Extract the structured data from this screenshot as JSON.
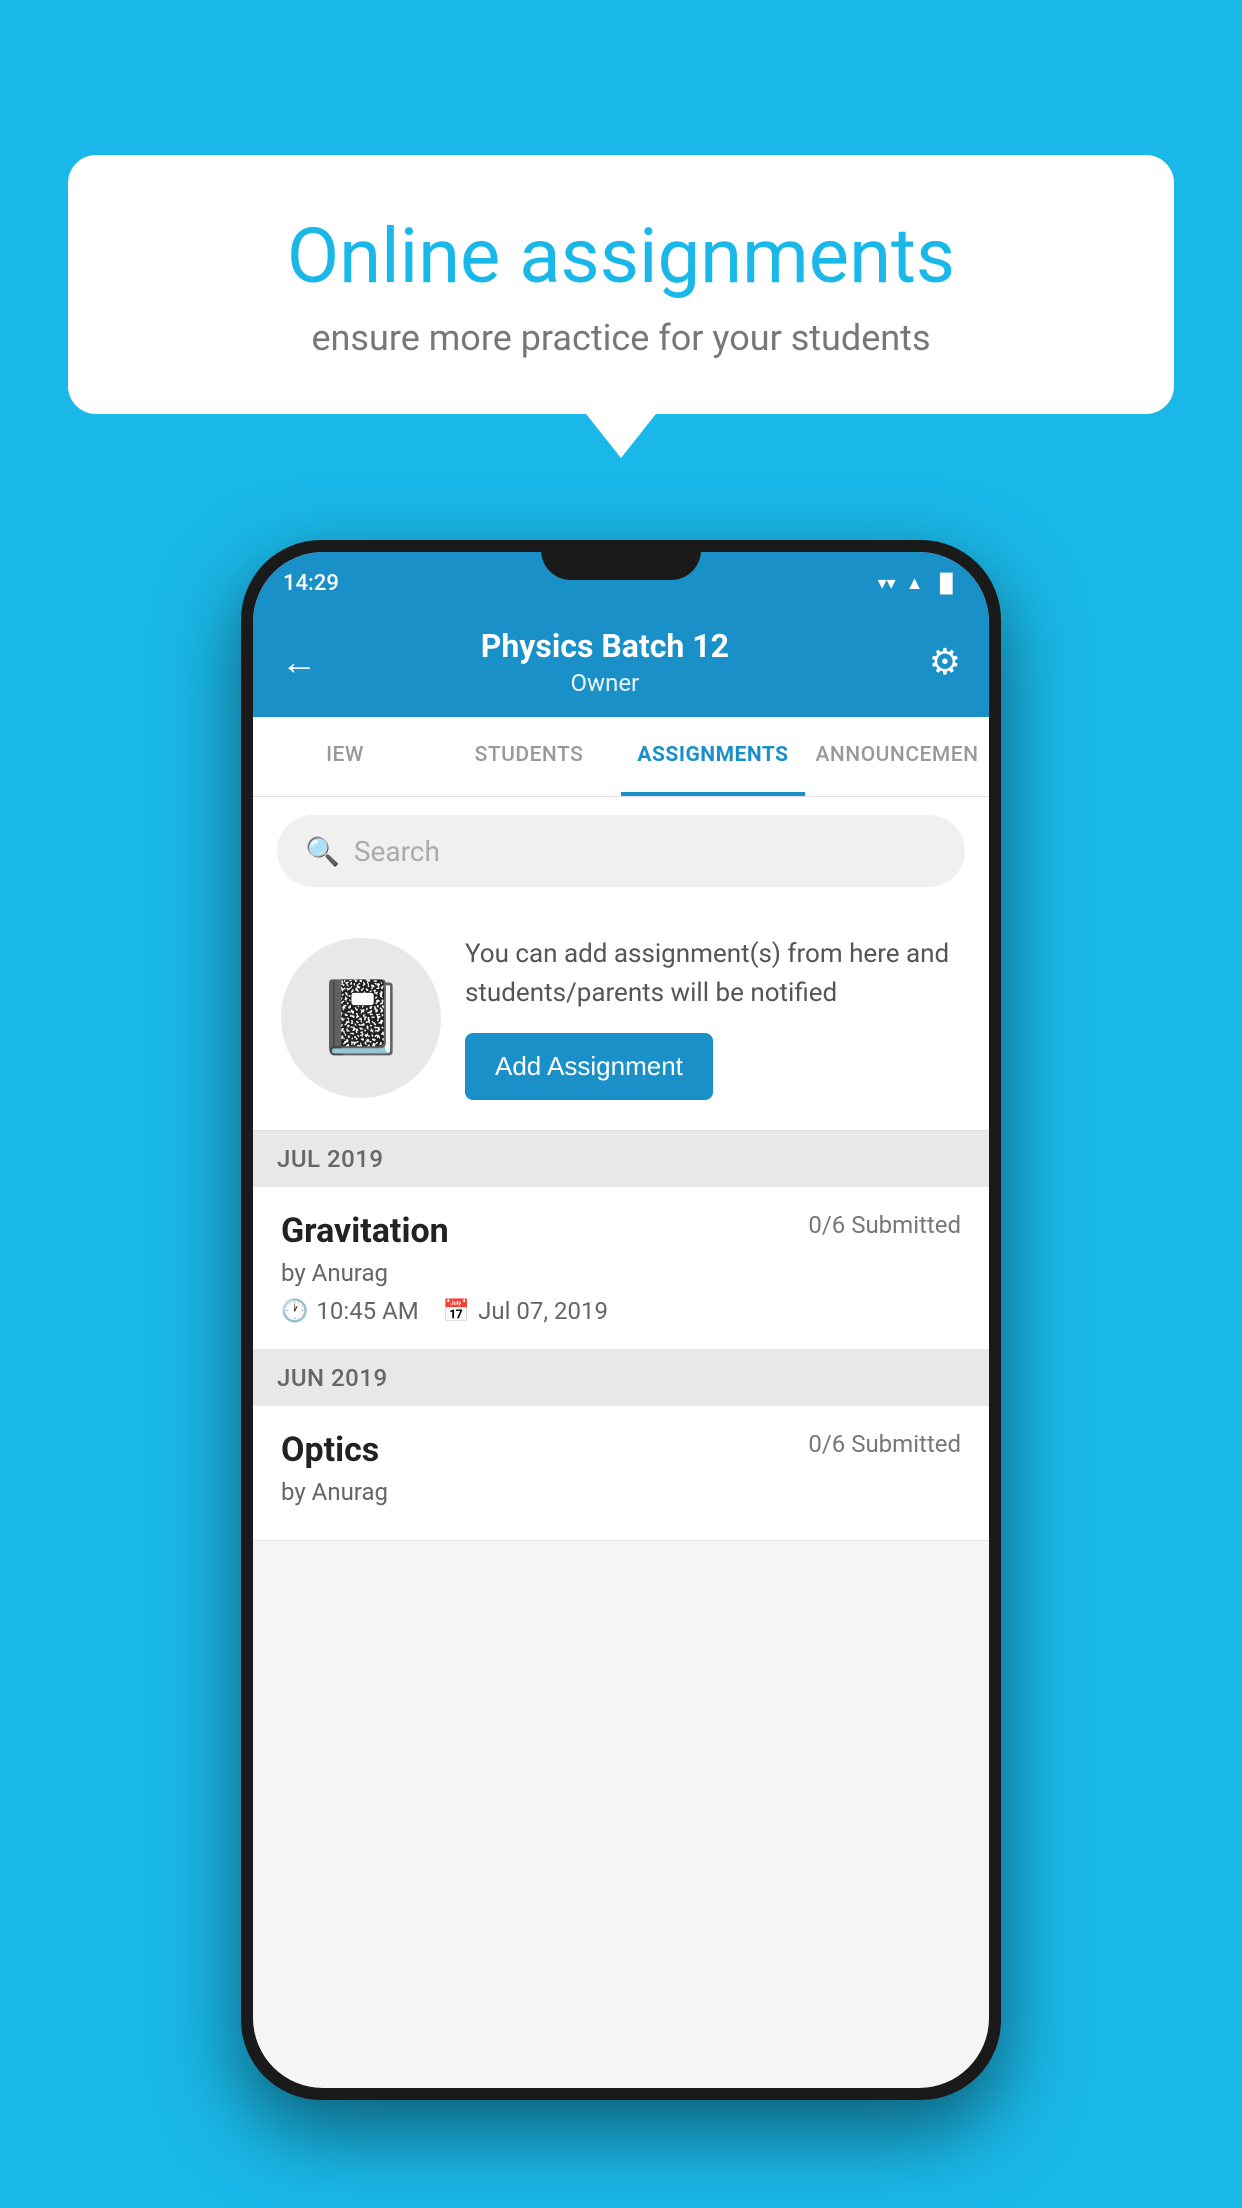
{
  "background": {
    "color": "#1ab8e8"
  },
  "speech_bubble": {
    "title": "Online assignments",
    "subtitle": "ensure more practice for your students"
  },
  "status_bar": {
    "time": "14:29",
    "wifi_icon": "▼",
    "signal_icon": "▲",
    "battery_icon": "▐"
  },
  "app_bar": {
    "title": "Physics Batch 12",
    "subtitle": "Owner",
    "back_icon": "←",
    "settings_icon": "⚙"
  },
  "tabs": [
    {
      "label": "IEW",
      "active": false
    },
    {
      "label": "STUDENTS",
      "active": false
    },
    {
      "label": "ASSIGNMENTS",
      "active": true
    },
    {
      "label": "ANNOUNCEMENTS",
      "active": false
    }
  ],
  "search": {
    "placeholder": "Search"
  },
  "promo": {
    "description": "You can add assignment(s) from here and students/parents will be notified",
    "add_button_label": "Add Assignment"
  },
  "sections": [
    {
      "label": "JUL 2019",
      "assignments": [
        {
          "name": "Gravitation",
          "submitted": "0/6 Submitted",
          "author": "by Anurag",
          "time": "10:45 AM",
          "date": "Jul 07, 2019"
        }
      ]
    },
    {
      "label": "JUN 2019",
      "assignments": [
        {
          "name": "Optics",
          "submitted": "0/6 Submitted",
          "author": "by Anurag",
          "time": "",
          "date": ""
        }
      ]
    }
  ]
}
